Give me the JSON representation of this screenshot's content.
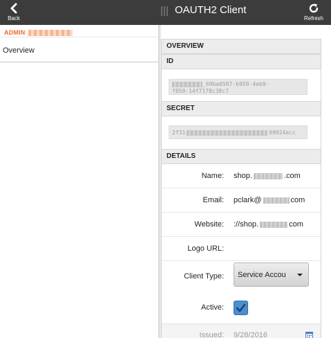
{
  "topbar": {
    "back_label": "Back",
    "title": "OAUTH2 Client",
    "refresh_label": "Refresh"
  },
  "sidebar": {
    "admin_label": "ADMIN",
    "items": [
      {
        "label": "Overview"
      }
    ]
  },
  "detail": {
    "overview_header": "OVERVIEW",
    "id_header": "ID",
    "id_value_line1": "_69ba0507-b959-4eb9-",
    "id_value_line2": "f850-14f7178c38c7",
    "secret_header": "SECRET",
    "secret_value_start": "2f31",
    "secret_value_end": "09924ecc",
    "details_header": "DETAILS",
    "fields": {
      "name": {
        "label": "Name:",
        "value_start": "shop.",
        "value_end": ".com"
      },
      "email": {
        "label": "Email:",
        "value_start": "pclark@",
        "value_end": "com"
      },
      "website": {
        "label": "Website:",
        "value_start": "://shop.",
        "value_end": "com"
      },
      "logo_url": {
        "label": "Logo URL:",
        "value": ""
      },
      "client_type": {
        "label": "Client Type:",
        "selected": "Service Accou"
      },
      "active": {
        "label": "Active:",
        "checked": true
      },
      "issued": {
        "label": "Issued:",
        "value": "9/28/2016"
      }
    }
  },
  "icons": {
    "back": "chevron-left-icon",
    "refresh": "refresh-icon",
    "dropdown": "caret-down-icon",
    "checkbox": "checkmark-icon",
    "calendar": "calendar-icon"
  },
  "colors": {
    "topbar_bg": "#3c3c3c",
    "admin_accent": "#ee6a2b",
    "checkbox_blue": "#4a8fd2"
  }
}
